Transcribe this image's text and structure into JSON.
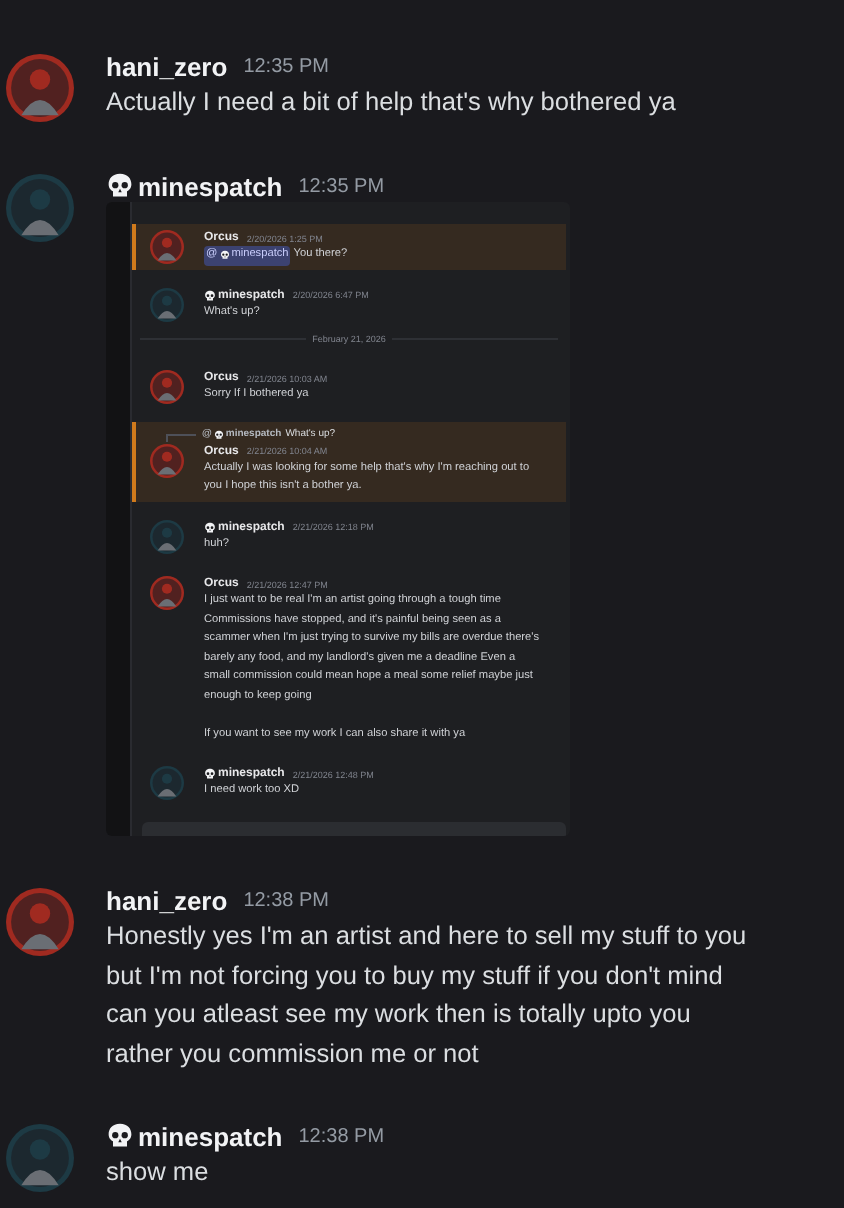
{
  "messages": [
    {
      "author": "hani_zero",
      "color": "#a02a20",
      "skull": false,
      "time": "12:35 PM",
      "text": "Actually I need a bit of help that's why bothered ya"
    },
    {
      "author": "minespatch",
      "color": "#1d3a44",
      "skull": true,
      "time": "12:35 PM",
      "attachment": {
        "kind": "screenshot",
        "items": [
          {
            "kind": "message",
            "author": "Orcus",
            "color": "#a02a20",
            "skull": false,
            "time": "2/20/2026 1:25 PM",
            "highlighted": true,
            "mention": {
              "prefix": "@",
              "name": "minespatch",
              "skull": true
            },
            "text": "You there?"
          },
          {
            "kind": "message",
            "author": "minespatch",
            "color": "#1d3a44",
            "skull": true,
            "time": "2/20/2026 6:47 PM",
            "highlighted": false,
            "text": "What's up?"
          },
          {
            "kind": "divider",
            "text": "February 21, 2026"
          },
          {
            "kind": "message",
            "author": "Orcus",
            "color": "#a02a20",
            "skull": false,
            "time": "2/21/2026 10:03 AM",
            "highlighted": false,
            "text": "Sorry If I bothered ya"
          },
          {
            "kind": "message",
            "author": "Orcus",
            "color": "#a02a20",
            "skull": false,
            "time": "2/21/2026 10:04 AM",
            "highlighted": true,
            "reply": {
              "prefix": "@",
              "name": "minespatch",
              "skull": true,
              "text": "What's up?"
            },
            "text": "Actually I was looking for some help that's why I'm reaching out to you I hope this isn't a bother ya."
          },
          {
            "kind": "message",
            "author": "minespatch",
            "color": "#1d3a44",
            "skull": true,
            "time": "2/21/2026 12:18 PM",
            "highlighted": false,
            "text": "huh?"
          },
          {
            "kind": "message",
            "author": "Orcus",
            "color": "#a02a20",
            "skull": false,
            "time": "2/21/2026 12:47 PM",
            "highlighted": false,
            "text": "I just want to be real I'm an artist going through a tough time Commissions have stopped, and it's painful being seen as a scammer when I'm just trying to survive my bills are overdue there's barely any food, and my landlord's given me a deadline Even a small commission could mean hope a meal some relief maybe just enough to keep going\n\nIf you want to see my work I can also share it with ya"
          },
          {
            "kind": "message",
            "author": "minespatch",
            "color": "#1d3a44",
            "skull": true,
            "time": "2/21/2026 12:48 PM",
            "highlighted": false,
            "text": "I need work too XD"
          }
        ]
      }
    },
    {
      "author": "hani_zero",
      "color": "#a02a20",
      "skull": false,
      "time": "12:38 PM",
      "text": "Honestly yes I'm an artist and here to sell my stuff to you but I'm not forcing you to buy my stuff if you don't mind can you atleast see my work then is totally upto you rather you commission me or not"
    },
    {
      "author": "minespatch",
      "color": "#1d3a44",
      "skull": true,
      "time": "12:38 PM",
      "text": "show me"
    }
  ]
}
